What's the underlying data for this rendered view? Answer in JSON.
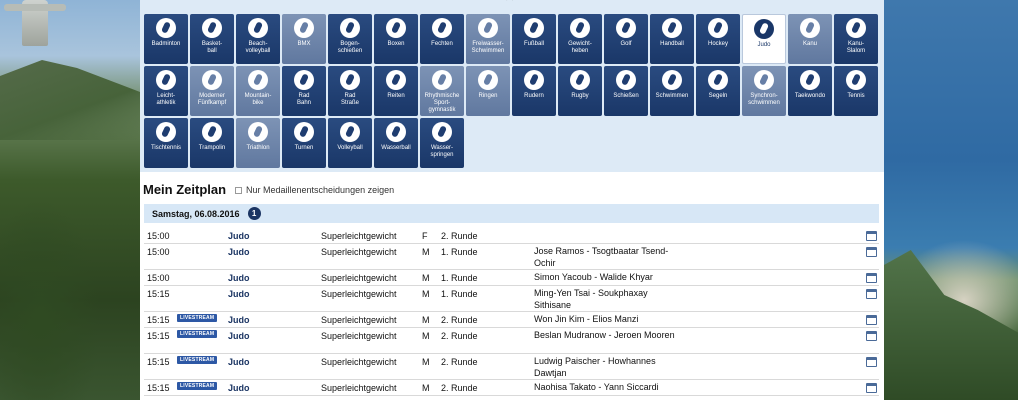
{
  "sports": [
    {
      "label": "Badminton",
      "variant": "dark",
      "icon": "badminton-icon"
    },
    {
      "label": "Basket-\nball",
      "variant": "dark",
      "icon": "basketball-icon"
    },
    {
      "label": "Beach-\nvolleyball",
      "variant": "dark",
      "icon": "beach-volleyball-icon"
    },
    {
      "label": "BMX",
      "variant": "light",
      "icon": "bmx-icon"
    },
    {
      "label": "Bogen-\nschießen",
      "variant": "dark",
      "icon": "archery-icon"
    },
    {
      "label": "Boxen",
      "variant": "dark",
      "icon": "boxing-icon"
    },
    {
      "label": "Fechten",
      "variant": "dark",
      "icon": "fencing-icon"
    },
    {
      "label": "Freiwasser-\nSchwimmen",
      "variant": "light",
      "icon": "open-water-swimming-icon"
    },
    {
      "label": "Fußball",
      "variant": "dark",
      "icon": "football-icon"
    },
    {
      "label": "Gewicht-\nheben",
      "variant": "dark",
      "icon": "weightlifting-icon"
    },
    {
      "label": "Golf",
      "variant": "dark",
      "icon": "golf-icon"
    },
    {
      "label": "Handball",
      "variant": "dark",
      "icon": "handball-icon"
    },
    {
      "label": "Hockey",
      "variant": "dark",
      "icon": "hockey-icon"
    },
    {
      "label": "Judo",
      "variant": "active",
      "icon": "judo-icon"
    },
    {
      "label": "Kanu",
      "variant": "light",
      "icon": "canoe-icon"
    },
    {
      "label": "Kanu-\nSlalom",
      "variant": "dark",
      "icon": "canoe-slalom-icon"
    },
    {
      "label": "Leicht-\nathletik",
      "variant": "dark",
      "icon": "athletics-icon"
    },
    {
      "label": "Moderner\nFünfkampf",
      "variant": "light",
      "icon": "modern-pentathlon-icon"
    },
    {
      "label": "Mountain-\nbike",
      "variant": "light",
      "icon": "mountain-bike-icon"
    },
    {
      "label": "Rad\nBahn",
      "variant": "dark",
      "icon": "track-cycling-icon"
    },
    {
      "label": "Rad\nStraße",
      "variant": "dark",
      "icon": "road-cycling-icon"
    },
    {
      "label": "Reiten",
      "variant": "dark",
      "icon": "equestrian-icon"
    },
    {
      "label": "Rhythmische\nSport-\ngymnastik",
      "variant": "light",
      "icon": "rhythmic-gymnastics-icon"
    },
    {
      "label": "Ringen",
      "variant": "light",
      "icon": "wrestling-icon"
    },
    {
      "label": "Rudern",
      "variant": "dark",
      "icon": "rowing-icon"
    },
    {
      "label": "Rugby",
      "variant": "dark",
      "icon": "rugby-icon"
    },
    {
      "label": "Schießen",
      "variant": "dark",
      "icon": "shooting-icon"
    },
    {
      "label": "Schwimmen",
      "variant": "dark",
      "icon": "swimming-icon"
    },
    {
      "label": "Segeln",
      "variant": "dark",
      "icon": "sailing-icon"
    },
    {
      "label": "Synchron-\nschwimmen",
      "variant": "light",
      "icon": "synchronized-swimming-icon"
    },
    {
      "label": "Taekwondo",
      "variant": "dark",
      "icon": "taekwondo-icon"
    },
    {
      "label": "Tennis",
      "variant": "dark",
      "icon": "tennis-icon"
    },
    {
      "label": "Tischtennis",
      "variant": "dark",
      "icon": "table-tennis-icon"
    },
    {
      "label": "Trampolin",
      "variant": "dark",
      "icon": "trampoline-icon"
    },
    {
      "label": "Triathlon",
      "variant": "light",
      "icon": "triathlon-icon"
    },
    {
      "label": "Turnen",
      "variant": "dark",
      "icon": "gymnastics-icon"
    },
    {
      "label": "Volleyball",
      "variant": "dark",
      "icon": "volleyball-icon"
    },
    {
      "label": "Wasserball",
      "variant": "dark",
      "icon": "water-polo-icon"
    },
    {
      "label": "Wasser-\nspringen",
      "variant": "dark",
      "icon": "diving-icon"
    }
  ],
  "close_glyph": "×",
  "schedule": {
    "title": "Mein Zeitplan",
    "filter_label": "Nur Medaillenentscheidungen zeigen",
    "date": "Samstag, 06.08.2016",
    "broadcaster_logo_text": "1",
    "livestream_label": "LIVESTREAM",
    "rows": [
      {
        "time": "15:00",
        "live": false,
        "sport": "Judo",
        "event": "Superleichtgewicht",
        "gender": "F",
        "round": "2. Runde",
        "match": ""
      },
      {
        "time": "15:00",
        "live": false,
        "sport": "Judo",
        "event": "Superleichtgewicht",
        "gender": "M",
        "round": "1. Runde",
        "match": "Jose Ramos - Tsogtbaatar Tsend-Ochir"
      },
      {
        "time": "15:00",
        "live": false,
        "sport": "Judo",
        "event": "Superleichtgewicht",
        "gender": "M",
        "round": "1. Runde",
        "match": "Simon Yacoub - Walide Khyar"
      },
      {
        "time": "15:15",
        "live": false,
        "sport": "Judo",
        "event": "Superleichtgewicht",
        "gender": "M",
        "round": "1. Runde",
        "match": "Ming-Yen Tsai - Soukphaxay Sithisane"
      },
      {
        "time": "15:15",
        "live": true,
        "sport": "Judo",
        "event": "Superleichtgewicht",
        "gender": "M",
        "round": "2. Runde",
        "match": "Won Jin Kim - Elios Manzi"
      },
      {
        "time": "15:15",
        "live": true,
        "sport": "Judo",
        "event": "Superleichtgewicht",
        "gender": "M",
        "round": "2. Runde",
        "match": "Beslan Mudranow - Jeroen Mooren"
      },
      {
        "time": "15:15",
        "live": true,
        "sport": "Judo",
        "event": "Superleichtgewicht",
        "gender": "M",
        "round": "2. Runde",
        "match": "Ludwig Paischer - Howhannes Dawtjan"
      },
      {
        "time": "15:15",
        "live": true,
        "sport": "Judo",
        "event": "Superleichtgewicht",
        "gender": "M",
        "round": "2. Runde",
        "match": "Naohisa Takato - Yann Siccardi"
      }
    ]
  }
}
